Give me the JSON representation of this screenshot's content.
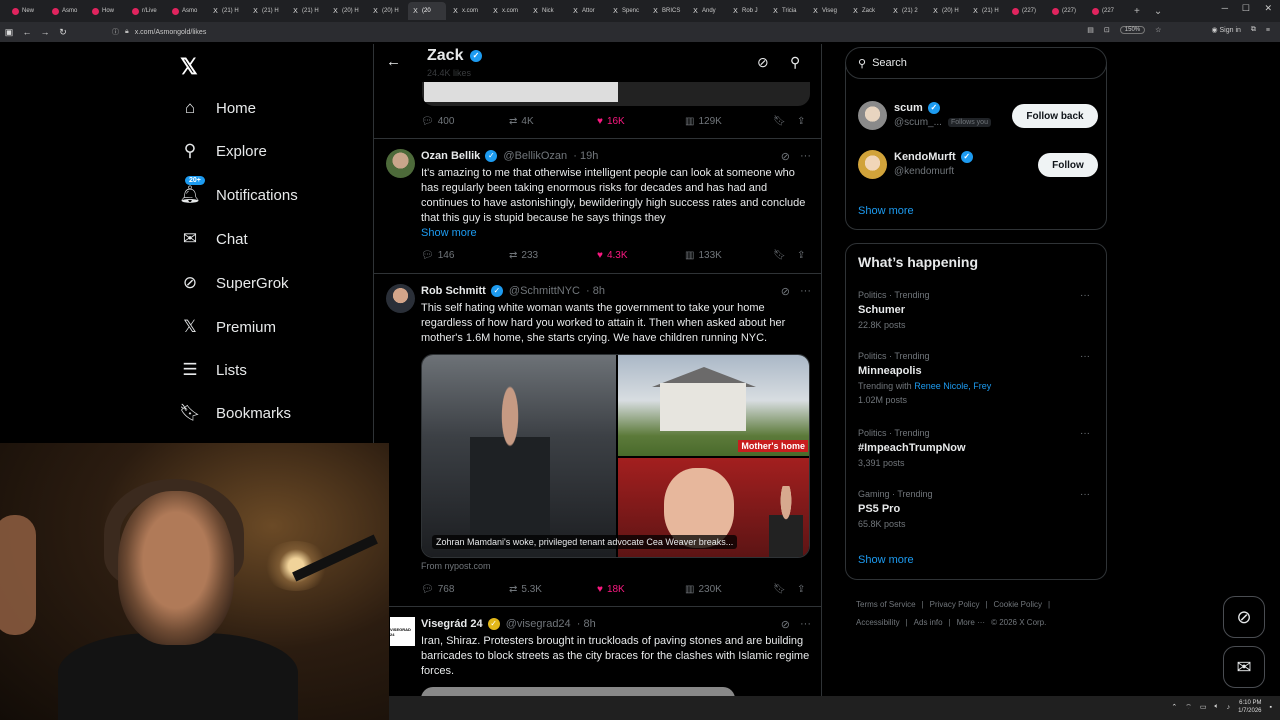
{
  "browser": {
    "tabs": [
      {
        "label": "New",
        "icon": "red"
      },
      {
        "label": "Asmo",
        "icon": "red"
      },
      {
        "label": "How",
        "icon": "red"
      },
      {
        "label": "r/Live",
        "icon": "red"
      },
      {
        "label": "Asmo",
        "icon": "red"
      },
      {
        "label": "(21) H",
        "icon": "x"
      },
      {
        "label": "(21) H",
        "icon": "x"
      },
      {
        "label": "(21) H",
        "icon": "x"
      },
      {
        "label": "(20) H",
        "icon": "x"
      },
      {
        "label": "(20) H",
        "icon": "x"
      },
      {
        "label": "(20",
        "icon": "x",
        "active": true
      },
      {
        "label": "x.com",
        "icon": "x"
      },
      {
        "label": "x.com",
        "icon": "x"
      },
      {
        "label": "Nick",
        "icon": "x"
      },
      {
        "label": "Attor",
        "icon": "x"
      },
      {
        "label": "Spenc",
        "icon": "x"
      },
      {
        "label": "BRICS",
        "icon": "x"
      },
      {
        "label": "Andy",
        "icon": "x"
      },
      {
        "label": "Rob J",
        "icon": "x"
      },
      {
        "label": "Tricia",
        "icon": "x"
      },
      {
        "label": "Viseg",
        "icon": "x"
      },
      {
        "label": "Zack",
        "icon": "x"
      },
      {
        "label": "(21) 2",
        "icon": "x"
      },
      {
        "label": "(20) H",
        "icon": "x"
      },
      {
        "label": "(21) H",
        "icon": "x"
      },
      {
        "label": "(227)",
        "icon": "red"
      },
      {
        "label": "(227)",
        "icon": "red"
      },
      {
        "label": "(227",
        "icon": "red"
      }
    ],
    "url": "x.com/Asmongold/likes",
    "zoom": "150%",
    "signin": "Sign in"
  },
  "nav": {
    "items": [
      {
        "name": "home",
        "label": "Home",
        "icon": "⌂"
      },
      {
        "name": "explore",
        "label": "Explore",
        "icon": "⚲"
      },
      {
        "name": "notifications",
        "label": "Notifications",
        "icon": "🔔︎",
        "badge": "20+"
      },
      {
        "name": "chat",
        "label": "Chat",
        "icon": "✉"
      },
      {
        "name": "supergrok",
        "label": "SuperGrok",
        "icon": "⊘"
      },
      {
        "name": "premium",
        "label": "Premium",
        "icon": "𝕏"
      },
      {
        "name": "lists",
        "label": "Lists",
        "icon": "☰"
      },
      {
        "name": "bookmarks",
        "label": "Bookmarks",
        "icon": "🔖︎"
      }
    ]
  },
  "header": {
    "name": "Zack",
    "sub": "24.4K likes"
  },
  "prev_tweet": {
    "replies": "400",
    "retweets": "4K",
    "likes": "16K",
    "views": "129K"
  },
  "tweets": [
    {
      "name": "Ozan Bellik",
      "handle": "@BellikOzan",
      "time": "· 19h",
      "text": "It's amazing to me that otherwise intelligent people can look at someone who has regularly been taking enormous risks for decades and has had and continues to have astonishingly, bewilderingly high success rates and conclude that this guy is stupid because he says things they",
      "show_more": "Show more",
      "replies": "146",
      "retweets": "233",
      "likes": "4.3K",
      "views": "133K"
    },
    {
      "name": "Rob Schmitt",
      "handle": "@SchmittNYC",
      "time": "· 8h",
      "text": "This self hating white woman wants the government to take your home regardless of how hard you worked to attain it. Then when asked about her mother's 1.6M home, she starts crying. We have children running NYC.",
      "media_tag": "Mother's home",
      "media_caption": "Zohran Mamdani's woke, privileged tenant advocate Cea Weaver breaks...",
      "from": "From nypost.com",
      "replies": "768",
      "retweets": "5.3K",
      "likes": "18K",
      "views": "230K"
    },
    {
      "name": "Visegrád 24",
      "handle": "@visegrad24",
      "time": "· 8h",
      "avatar_text": "VISEGRAD 24",
      "text": "Iran, Shiraz. Protesters brought in truckloads of paving stones and are building barricades to block streets as the city braces for the clashes with Islamic regime forces."
    }
  ],
  "search": {
    "placeholder": "Search"
  },
  "who_to_follow": {
    "users": [
      {
        "name": "scum",
        "handle": "@scum_...",
        "follows_you": "Follows you",
        "button": "Follow back"
      },
      {
        "name": "KendoMurft",
        "handle": "@kendomurft",
        "button": "Follow"
      }
    ],
    "show_more": "Show more"
  },
  "whats_happening": {
    "title": "What’s happening",
    "trends": [
      {
        "category": "Politics · Trending",
        "topic": "Schumer",
        "posts": "22.8K posts"
      },
      {
        "category": "Politics · Trending",
        "topic": "Minneapolis",
        "trending_with_label": "Trending with",
        "trending_with": "Renee Nicole, Frey",
        "posts": "1.02M posts"
      },
      {
        "category": "Politics · Trending",
        "topic": "#ImpeachTrumpNow",
        "posts": "3,391 posts"
      },
      {
        "category": "Gaming · Trending",
        "topic": "PS5 Pro",
        "posts": "65.8K posts"
      }
    ],
    "show_more": "Show more"
  },
  "footer": {
    "links": [
      "Terms of Service",
      "|",
      "Privacy Policy",
      "|",
      "Cookie Policy",
      "|",
      "Accessibility",
      "|",
      "Ads info",
      "|",
      "More ···",
      "© 2026 X Corp."
    ]
  },
  "taskbar": {
    "time": "6:10 PM",
    "date": "1/7/2026"
  },
  "colors": {
    "accent": "#1d9bf0",
    "like": "#f91880",
    "border": "#2f3336"
  }
}
